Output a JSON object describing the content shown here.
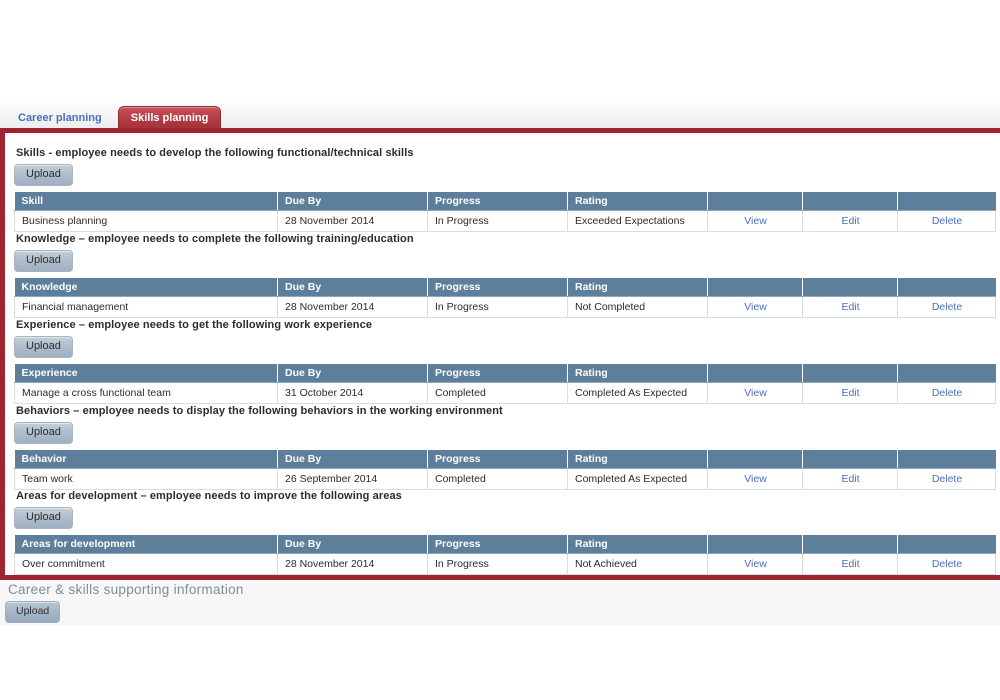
{
  "tabs": [
    {
      "label": "Career planning",
      "active": false
    },
    {
      "label": "Skills planning",
      "active": true
    }
  ],
  "upload_label": "Upload",
  "columns": {
    "due_by": "Due By",
    "progress": "Progress",
    "rating": "Rating",
    "view": "View",
    "edit": "Edit",
    "delete": "Delete"
  },
  "sections": [
    {
      "title": "Skills - employee needs to develop the following functional/technical skills",
      "upload_label": "Upload",
      "first_column": "Skill",
      "rows": [
        {
          "name": "Business planning",
          "due_by": "28 November 2014",
          "progress": "In Progress",
          "rating": "Exceeded Expectations",
          "view": "View",
          "edit": "Edit",
          "delete": "Delete"
        }
      ]
    },
    {
      "title": "Knowledge – employee needs to complete the following training/education",
      "upload_label": "Upload",
      "first_column": "Knowledge",
      "rows": [
        {
          "name": "Financial management",
          "due_by": "28 November 2014",
          "progress": "In Progress",
          "rating": "Not Completed",
          "view": "View",
          "edit": "Edit",
          "delete": "Delete"
        }
      ]
    },
    {
      "title": "Experience – employee needs to get the following work experience",
      "upload_label": "Upload",
      "first_column": "Experience",
      "rows": [
        {
          "name": "Manage a cross functional team",
          "due_by": "31 October 2014",
          "progress": "Completed",
          "rating": "Completed As Expected",
          "view": "View",
          "edit": "Edit",
          "delete": "Delete"
        }
      ]
    },
    {
      "title": "Behaviors – employee needs to display the following behaviors in the working environment",
      "upload_label": "Upload",
      "first_column": "Behavior",
      "rows": [
        {
          "name": "Team work",
          "due_by": "26 September 2014",
          "progress": "Completed",
          "rating": "Completed As Expected",
          "view": "View",
          "edit": "Edit",
          "delete": "Delete"
        }
      ]
    },
    {
      "title": "Areas for development – employee needs to improve the following areas",
      "upload_label": "Upload",
      "first_column": "Areas for development",
      "rows": [
        {
          "name": "Over commitment",
          "due_by": "28 November 2014",
          "progress": "In Progress",
          "rating": "Not Achieved",
          "view": "View",
          "edit": "Edit",
          "delete": "Delete"
        }
      ]
    }
  ],
  "supporting": {
    "title": "Career & skills supporting information",
    "upload_label": "Upload"
  },
  "colors": {
    "accent_red": "#9e2430",
    "tab_active": "#b23b44",
    "table_header": "#5d7f9b",
    "link": "#4a6fbd",
    "support_title": "#7d8d9c"
  }
}
